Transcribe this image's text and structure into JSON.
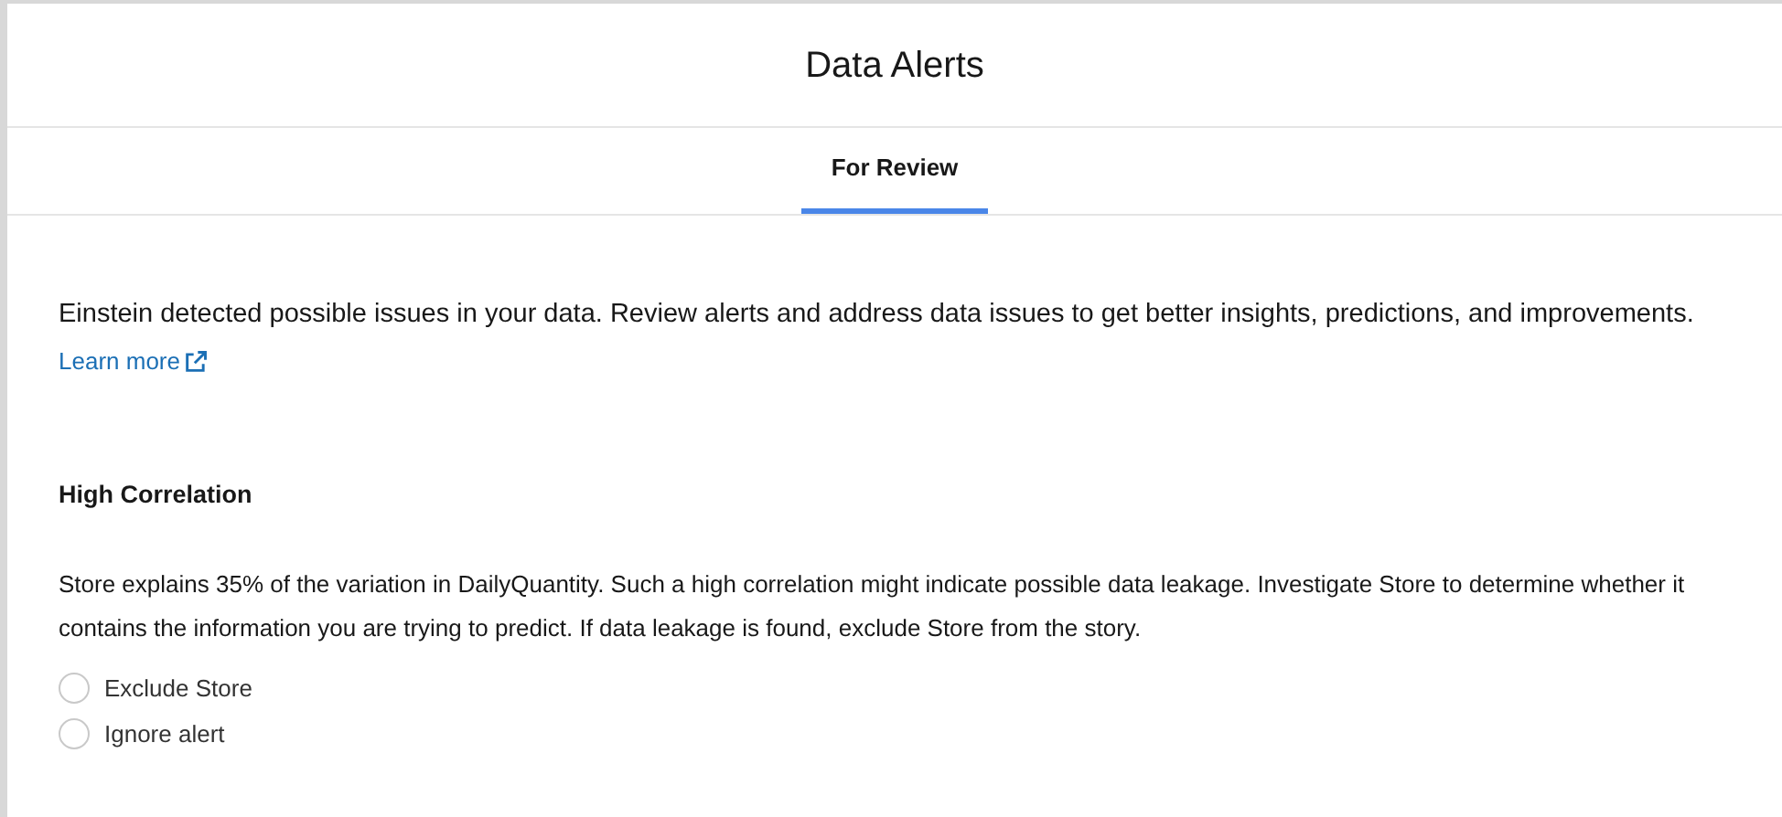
{
  "window": {
    "title": "Data Alerts"
  },
  "tabs": [
    {
      "label": "For Review",
      "selected": true
    }
  ],
  "intro": {
    "text": "Einstein detected possible issues in your data. Review alerts and address data issues to get better insights, predictions, and improvements.",
    "link": "Learn more"
  },
  "alert": {
    "title": "High Correlation",
    "description": "Store explains 35% of the variation in DailyQuantity. Such a high correlation might indicate possible data leakage. Investigate Store to determine whether it contains the information you are trying to predict. If data leakage is found, exclude Store from the story.",
    "options": [
      {
        "label": "Exclude Store",
        "selected": false
      },
      {
        "label": "Ignore alert",
        "selected": false
      }
    ]
  }
}
